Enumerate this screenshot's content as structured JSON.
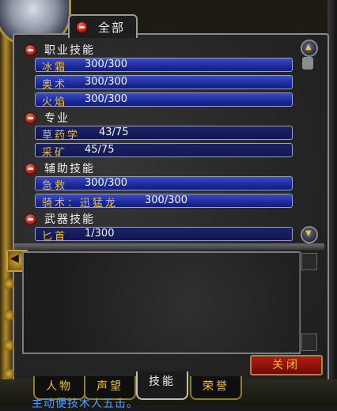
{
  "tabs": {
    "all_label": "全部"
  },
  "categories": [
    {
      "name": "职业技能",
      "skills": [
        {
          "name": "冰霜",
          "value": "300/300",
          "max": 300,
          "current": 300
        },
        {
          "name": "奥术",
          "value": "300/300",
          "max": 300,
          "current": 300
        },
        {
          "name": "火焰",
          "value": "300/300",
          "max": 300,
          "current": 300
        }
      ]
    },
    {
      "name": "专业",
      "skills": [
        {
          "name": "草药学",
          "value": "43/75",
          "max": 75,
          "current": 43
        },
        {
          "name": "采矿",
          "value": "45/75",
          "max": 75,
          "current": 45
        }
      ]
    },
    {
      "name": "辅助技能",
      "skills": [
        {
          "name": "急救",
          "value": "300/300",
          "max": 300,
          "current": 300
        },
        {
          "name": "骑术：迅猛龙",
          "value": "300/300",
          "max": 300,
          "current": 300
        }
      ]
    },
    {
      "name": "武器技能",
      "skills": [
        {
          "name": "匕首",
          "value": "1/300",
          "max": 300,
          "current": 1
        }
      ]
    }
  ],
  "close_label": "关闭",
  "bottom_tabs": [
    {
      "label": "人物"
    },
    {
      "label": "声望"
    },
    {
      "label": "技能"
    },
    {
      "label": "荣誉"
    }
  ],
  "chat_text": "主动便技术人五击。",
  "colors": {
    "skill_name": "#f3c21e",
    "bar_blue": "#1d2a9a",
    "close_red": "#b41a12"
  }
}
